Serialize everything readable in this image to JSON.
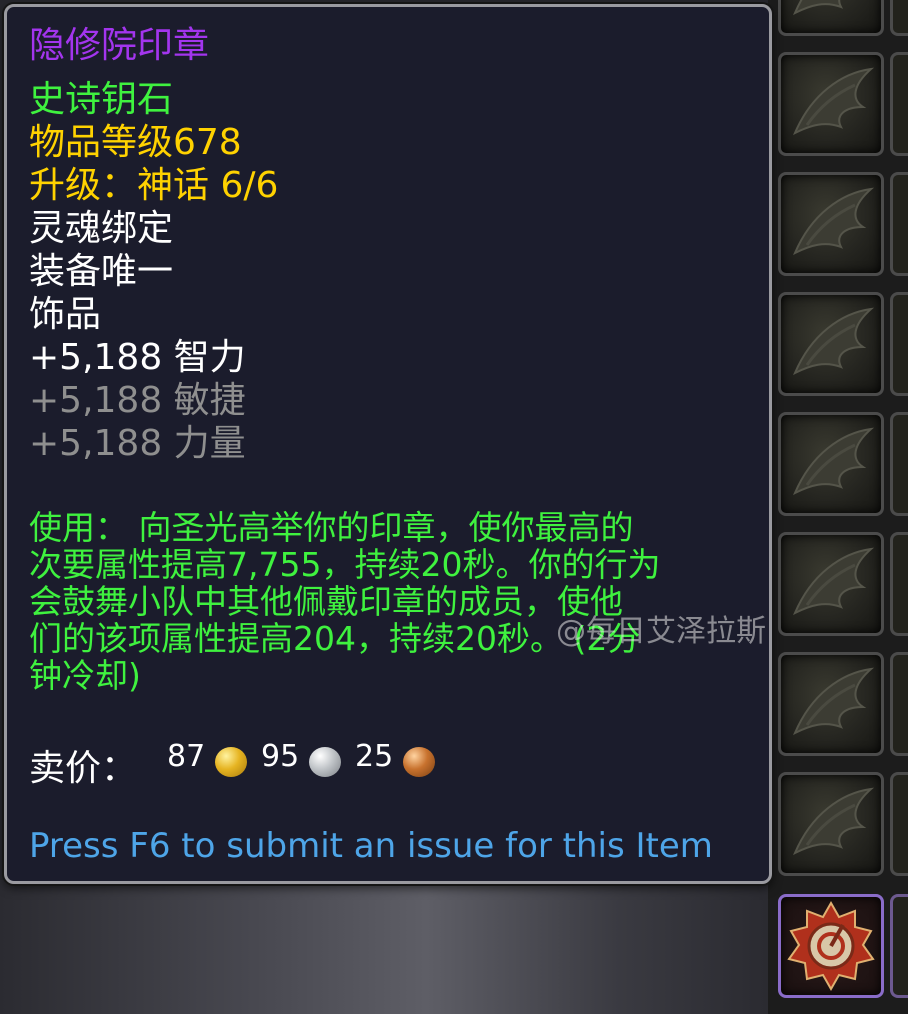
{
  "item": {
    "name": "隐修院印章",
    "type": "史诗钥石",
    "item_level": "物品等级678",
    "upgrade": "升级：神话 6/6",
    "bind": "灵魂绑定",
    "unique": "装备唯一",
    "slot": "饰品",
    "stats": [
      {
        "text": "+5,188 智力",
        "active": true
      },
      {
        "text": "+5,188 敏捷",
        "active": false
      },
      {
        "text": "+5,188 力量",
        "active": false
      }
    ],
    "use_lines": [
      "使用：  向圣光高举你的印章，使你最高的",
      "次要属性提高7,755，持续20秒。你的行为",
      "会鼓舞小队中其他佩戴印章的成员，使他",
      "们的该项属性提高204，持续20秒。  (2分",
      "钟冷却)"
    ],
    "sell_label": "卖价：",
    "sell_price": {
      "gold": "87",
      "silver": "95",
      "copper": "25"
    },
    "issue_hint": "Press F6 to submit an issue for this Item"
  },
  "watermark": "@每日艾泽拉斯",
  "colors": {
    "epic": "#a335ee",
    "green": "#3ff23f",
    "gold_text": "#ffd200",
    "hint_blue": "#4ea5e8",
    "tooltip_bg": "#1b1c2c"
  },
  "icons": {
    "bag_slot_item": "dark-wing-icon",
    "selected_item": "red-seal-icon"
  }
}
